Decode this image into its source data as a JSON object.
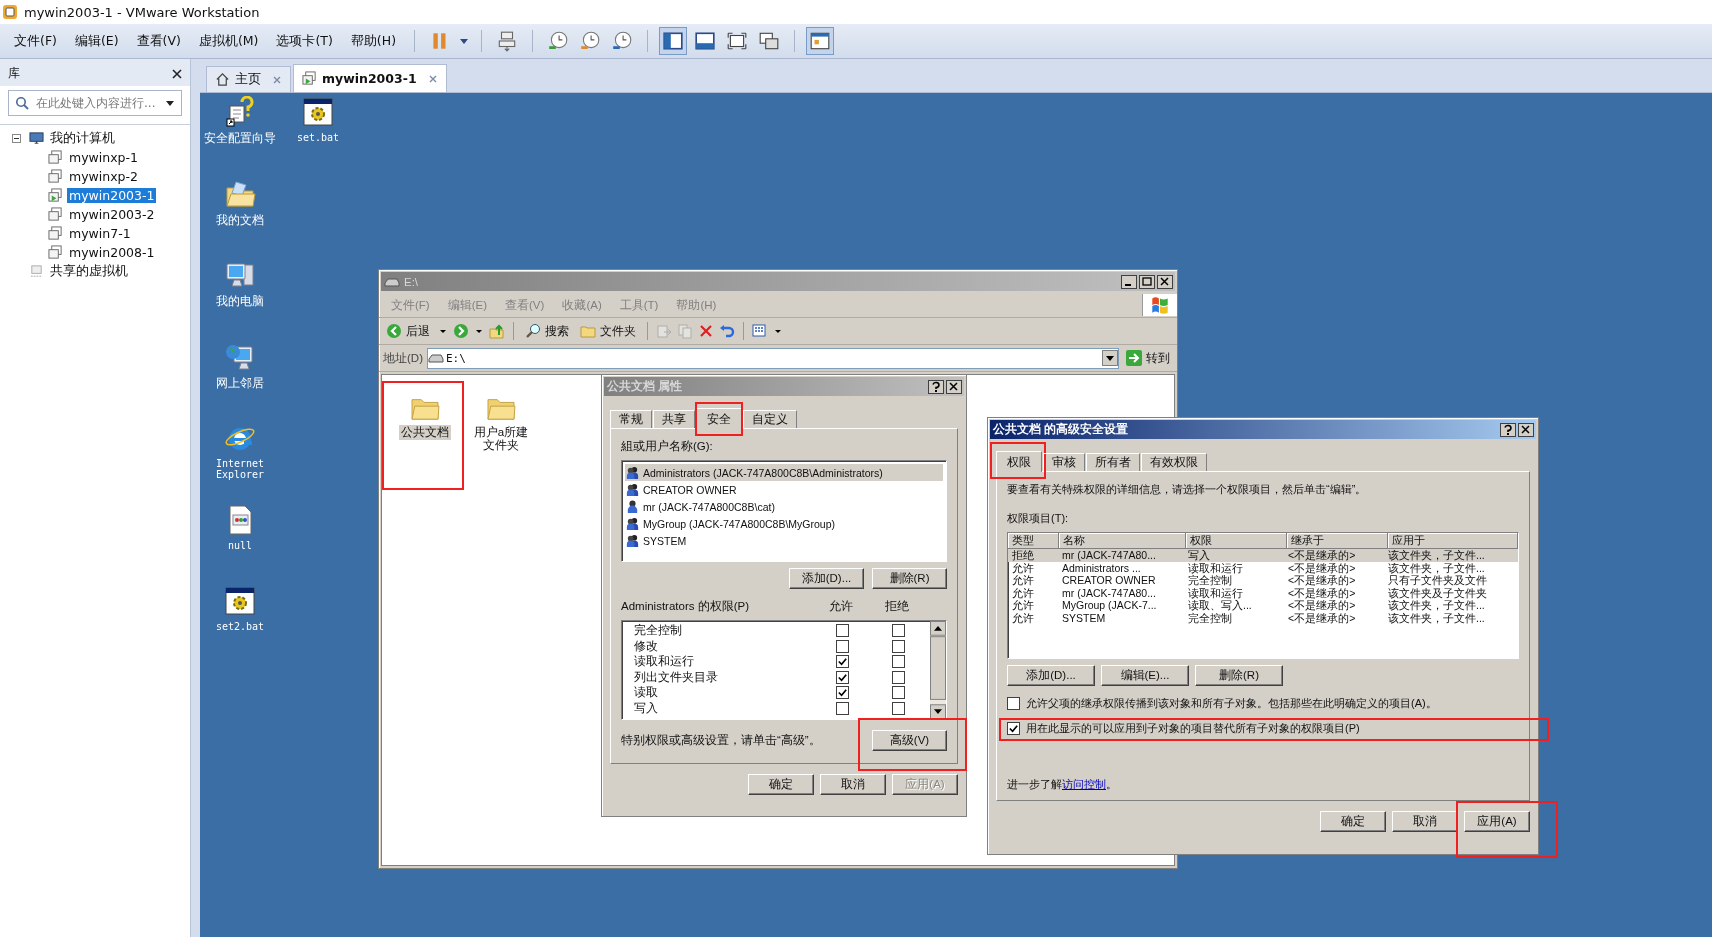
{
  "window": {
    "title": "mywin2003-1 - VMware Workstation"
  },
  "menu": [
    "文件(F)",
    "编辑(E)",
    "查看(V)",
    "虚拟机(M)",
    "选项卡(T)",
    "帮助(H)"
  ],
  "library": {
    "title": "库",
    "search": {
      "placeholder": "在此处键入内容进行..."
    },
    "tree": [
      {
        "label": "我的计算机",
        "expanded": true,
        "kind": "computer",
        "children": [
          {
            "label": "mywinxp-1",
            "selected": false,
            "running": false
          },
          {
            "label": "mywinxp-2",
            "selected": false,
            "running": false
          },
          {
            "label": "mywin2003-1",
            "selected": true,
            "running": true
          },
          {
            "label": "mywin2003-2",
            "selected": false,
            "running": false
          },
          {
            "label": "mywin7-1",
            "selected": false,
            "running": false
          },
          {
            "label": "mywin2008-1",
            "selected": false,
            "running": false
          }
        ]
      },
      {
        "label": "共享的虚拟机",
        "kind": "shared"
      }
    ]
  },
  "tabs": [
    {
      "label": "主页",
      "selected": false,
      "kind": "home"
    },
    {
      "label": "mywin2003-1",
      "selected": true,
      "kind": "vm"
    }
  ],
  "desktop": {
    "icons": [
      {
        "label": "安全配置向导",
        "kind": "wizard"
      },
      {
        "label": "set.bat",
        "kind": "bat"
      },
      {
        "label": "我的文档",
        "kind": "documents"
      },
      {
        "label": "我的电脑",
        "kind": "computer"
      },
      {
        "label": "网上邻居",
        "kind": "network"
      },
      {
        "label": "Internet Explorer",
        "kind": "ie"
      },
      {
        "label": "null",
        "kind": "file"
      },
      {
        "label": "set2.bat",
        "kind": "bat"
      }
    ]
  },
  "explorer": {
    "title": "E:\\",
    "menu": [
      "文件(F)",
      "编辑(E)",
      "查看(V)",
      "收藏(A)",
      "工具(T)",
      "帮助(H)"
    ],
    "back": "后退",
    "search": "搜索",
    "folders": "文件夹",
    "address_label": "地址(D)",
    "address": "E:\\",
    "go": "转到",
    "items": [
      {
        "label": "公共文档",
        "selected": true,
        "highlighted": true
      },
      {
        "label": "用户a所建文件夹",
        "selected": false,
        "highlighted": false
      }
    ]
  },
  "properties": {
    "title": "公共文档 属性",
    "tabs": [
      {
        "label": "常规",
        "selected": false,
        "highlighted": false
      },
      {
        "label": "共享",
        "selected": false,
        "highlighted": false
      },
      {
        "label": "安全",
        "selected": true,
        "highlighted": true
      },
      {
        "label": "自定义",
        "selected": false,
        "highlighted": false
      }
    ],
    "users_label": "組或用户名称(G):",
    "users": [
      {
        "name": "Administrators (JACK-747A800C8B\\Administrators)",
        "selected": true,
        "kind": "group"
      },
      {
        "name": "CREATOR OWNER",
        "selected": false,
        "kind": "group"
      },
      {
        "name": "mr (JACK-747A800C8B\\cat)",
        "selected": false,
        "kind": "user"
      },
      {
        "name": "MyGroup (JACK-747A800C8B\\MyGroup)",
        "selected": false,
        "kind": "group"
      },
      {
        "name": "SYSTEM",
        "selected": false,
        "kind": "group"
      }
    ],
    "add": "添加(D)...",
    "remove": "删除(R)",
    "perms_label": "Administrators 的权限(P)",
    "allow": "允许",
    "deny": "拒绝",
    "perms": [
      {
        "name": "完全控制",
        "allow": false,
        "deny": false
      },
      {
        "name": "修改",
        "allow": false,
        "deny": false
      },
      {
        "name": "读取和运行",
        "allow": true,
        "deny": false
      },
      {
        "name": "列出文件夹目录",
        "allow": true,
        "deny": false
      },
      {
        "name": "读取",
        "allow": true,
        "deny": false
      },
      {
        "name": "写入",
        "allow": false,
        "deny": false
      }
    ],
    "hint": "特别权限或高级设置，请单击“高级”。",
    "advanced_button": {
      "label": "高级(V)",
      "highlighted": true
    },
    "buttons": [
      {
        "label": "确定",
        "disabled": false
      },
      {
        "label": "取消",
        "disabled": false
      },
      {
        "label": "应用(A)",
        "disabled": true
      }
    ]
  },
  "advanced": {
    "title": "公共文档 的高级安全设置",
    "tabs": [
      {
        "label": "权限",
        "selected": true,
        "highlighted": true
      },
      {
        "label": "审核",
        "selected": false,
        "highlighted": false
      },
      {
        "label": "所有者",
        "selected": false,
        "highlighted": false
      },
      {
        "label": "有效权限",
        "selected": false,
        "highlighted": false
      }
    ],
    "intro": "要查看有关特殊权限的详细信息，请选择一个权限项目，然后单击“编辑”。",
    "entries_label": "权限项目(T):",
    "columns": [
      "类型",
      "名称",
      "权限",
      "继承于",
      "应用于"
    ],
    "rows": [
      {
        "selected": true,
        "cells": [
          "拒绝",
          "mr (JACK-747A80...",
          "写入",
          "<不是继承的>",
          "该文件夹，子文件..."
        ]
      },
      {
        "selected": false,
        "cells": [
          "允许",
          "Administrators ...",
          "读取和运行",
          "<不是继承的>",
          "该文件夹，子文件..."
        ]
      },
      {
        "selected": false,
        "cells": [
          "允许",
          "CREATOR OWNER",
          "完全控制",
          "<不是继承的>",
          "只有子文件夹及文件"
        ]
      },
      {
        "selected": false,
        "cells": [
          "允许",
          "mr (JACK-747A80...",
          "读取和运行",
          "<不是继承的>",
          "该文件夹及子文件夹"
        ]
      },
      {
        "selected": false,
        "cells": [
          "允许",
          "MyGroup (JACK-7...",
          "读取、写入...",
          "<不是继承的>",
          "该文件夹，子文件..."
        ]
      },
      {
        "selected": false,
        "cells": [
          "允许",
          "SYSTEM",
          "完全控制",
          "<不是继承的>",
          "该文件夹，子文件..."
        ]
      }
    ],
    "actions": [
      "添加(D)...",
      "编辑(E)...",
      "删除(R)"
    ],
    "options": [
      {
        "label": "允许父项的继承权限传播到该对象和所有子对象。包括那些在此明确定义的项目(A)。",
        "checked": false,
        "highlighted": false
      },
      {
        "label": "用在此显示的可以应用到子对象的项目替代所有子对象的权限项目(P)",
        "checked": true,
        "highlighted": true
      }
    ],
    "learn_text": "进一步了解",
    "learn_link": "访问控制",
    "learn_end": "。",
    "buttons": [
      {
        "label": "确定",
        "highlighted": false
      },
      {
        "label": "取消",
        "highlighted": false
      },
      {
        "label": "应用(A)",
        "highlighted": true
      }
    ]
  }
}
